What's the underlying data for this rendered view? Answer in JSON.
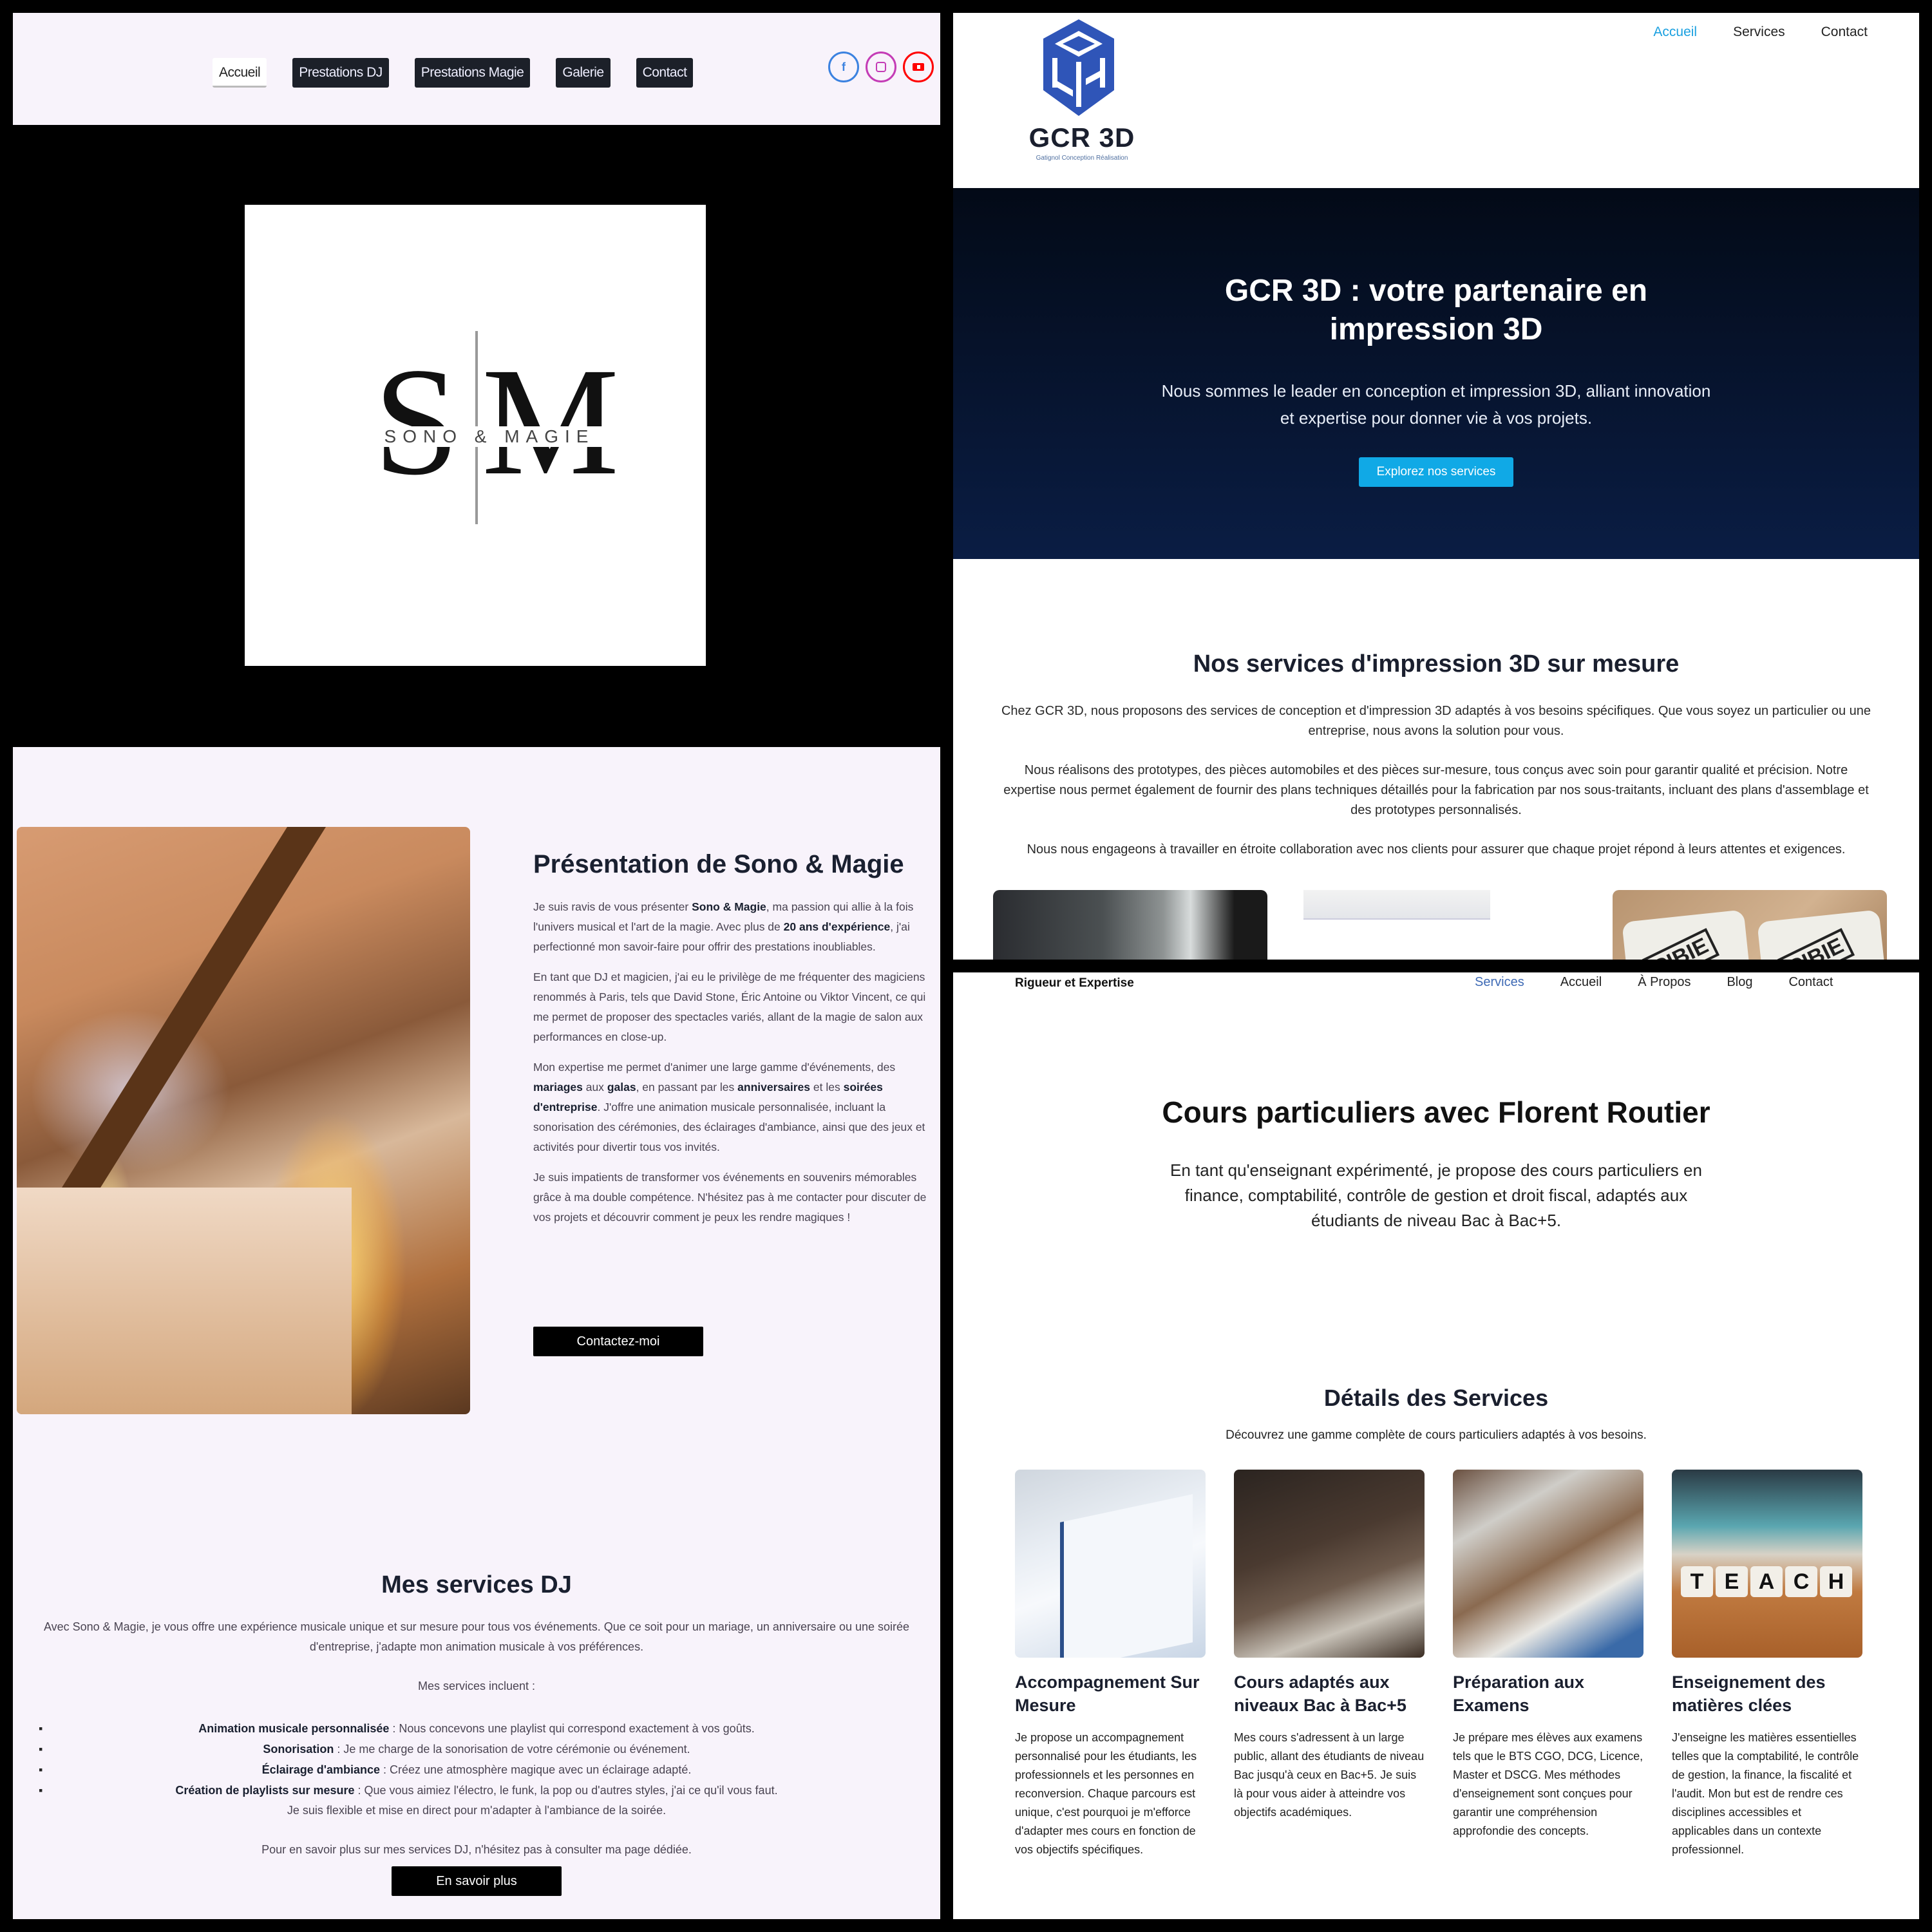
{
  "sono": {
    "nav": [
      {
        "label": "Accueil",
        "active": true
      },
      {
        "label": "Prestations DJ",
        "active": false
      },
      {
        "label": "Prestations Magie",
        "active": false
      },
      {
        "label": "Galerie",
        "active": false
      },
      {
        "label": "Contact",
        "active": false
      }
    ],
    "socials": [
      {
        "name": "facebook",
        "glyph": "f",
        "color": "#3b82e0"
      },
      {
        "name": "instagram",
        "glyph": "",
        "color": "#c43cb6"
      },
      {
        "name": "youtube",
        "glyph": "",
        "color": "#ff0000"
      }
    ],
    "logo": {
      "letter_left": "S",
      "letter_right": "M",
      "name": "SONO & MAGIE"
    },
    "presentation": {
      "title": "Présentation de Sono & Magie",
      "p1": {
        "a": "Je suis ravis de vous présenter ",
        "b1": "Sono & Magie",
        "c": ", ma passion qui allie à la fois l'univers musical et l'art de la magie. Avec plus de ",
        "b2": "20 ans d'expérience",
        "d": ", j'ai perfectionné mon savoir-faire pour offrir des prestations inoubliables."
      },
      "p2": "En tant que DJ et magicien, j'ai eu le privilège de me fréquenter des magiciens renommés à Paris, tels que David Stone, Éric Antoine ou Viktor Vincent, ce qui me permet de proposer des spectacles variés, allant de la magie de salon aux performances en close-up.",
      "p3": {
        "a": "Mon expertise me permet d'animer une large gamme d'événements, des ",
        "b1": "mariages",
        "c": " aux ",
        "b2": "galas",
        "d": ", en passant par les ",
        "b3": "anniversaires",
        "e": " et les ",
        "b4": "soirées d'entreprise",
        "f": ". J'offre une animation musicale personnalisée, incluant la sonorisation des cérémonies, des éclairages d'ambiance, ainsi que des jeux et activités pour divertir tous vos invités."
      },
      "p4": "Je suis impatients de transformer vos événements en souvenirs mémorables grâce à ma double compétence. N'hésitez pas à me contacter pour discuter de vos projets et découvrir comment je peux les rendre magiques !",
      "contact_button": "Contactez-moi"
    },
    "dj_services": {
      "title": "Mes services DJ",
      "intro": "Avec Sono & Magie, je vous offre une expérience musicale unique et sur mesure pour tous vos événements. Que ce soit pour un mariage, un anniversaire ou une soirée d'entreprise, j'adapte mon animation musicale à vos préférences.",
      "sub": "Mes services incluent :",
      "items": [
        {
          "bold": "Animation musicale personnalisée",
          "text": " : Nous concevons une playlist qui correspond exactement à vos goûts."
        },
        {
          "bold": "Sonorisation",
          "text": " : Je me charge de la sonorisation de votre cérémonie ou événement."
        },
        {
          "bold": "Éclairage d'ambiance",
          "text": " : Créez une atmosphère magique avec un éclairage adapté."
        },
        {
          "bold": "Création de playlists sur mesure",
          "text": " : Que vous aimiez l'électro, le funk, la pop ou d'autres styles, j'ai ce qu'il vous faut."
        }
      ],
      "flexible": "Je suis flexible et mise en direct pour m'adapter à l'ambiance de la soirée.",
      "more_text": "Pour en savoir plus sur mes services DJ, n'hésitez pas à consulter ma page dédiée.",
      "more_button": "En savoir plus"
    }
  },
  "gcr": {
    "logo": {
      "word": "GCR 3D",
      "tagline": "Gatignol Conception Réalisation",
      "color": "#2f55b8"
    },
    "nav": [
      {
        "label": "Accueil",
        "active": true
      },
      {
        "label": "Services",
        "active": false
      },
      {
        "label": "Contact",
        "active": false
      }
    ],
    "hero": {
      "title": "GCR 3D : votre partenaire en impression 3D",
      "text": "Nous sommes le leader en conception et impression 3D, alliant innovation et expertise pour donner vie à vos projets.",
      "cta": "Explorez nos services",
      "accent": "#10a9e6"
    },
    "services": {
      "title": "Nos services d'impression 3D sur mesure",
      "p1": "Chez GCR 3D, nous proposons des services de conception et d'impression 3D adaptés à vos besoins spécifiques. Que vous soyez un particulier ou une entreprise, nous avons la solution pour vous.",
      "p2": "Nous réalisons des prototypes, des pièces automobiles et des pièces sur-mesure, tous conçus avec soin pour garantir qualité et précision. Notre expertise nous permet également de fournir des plans techniques détaillés pour la fabrication par nos sous-traitants, incluant des plans d'assemblage et des prototypes personnalisés.",
      "p3": "Nous nous engageons à travailler en étroite collaboration avec nos clients pour assurer que chaque projet répond à leurs attentes et exigences.",
      "card_images": [
        "3d-printer-closeup",
        "cad-software-screenshot",
        "cibie-parts"
      ],
      "cibie_label": "CIBIE"
    }
  },
  "florent": {
    "brand": "Rigueur et Expertise",
    "nav": [
      {
        "label": "Services",
        "active": true
      },
      {
        "label": "Accueil",
        "active": false
      },
      {
        "label": "À Propos",
        "active": false
      },
      {
        "label": "Blog",
        "active": false
      },
      {
        "label": "Contact",
        "active": false
      }
    ],
    "hero": {
      "title": "Cours particuliers avec Florent Routier",
      "text": "En tant qu'enseignant expérimenté, je propose des cours particuliers en finance, comptabilité, contrôle de gestion et droit fiscal, adaptés aux étudiants de niveau Bac à Bac+5."
    },
    "details": {
      "title": "Détails des Services",
      "subtitle": "Découvrez une gamme complète de cours particuliers adaptés à vos besoins.",
      "cards": [
        {
          "title": "Accompagnement Sur Mesure",
          "image": "spreadsheet-charts",
          "text": "Je propose un accompagnement personnalisé pour les étudiants, les professionnels et les personnes en reconversion. Chaque parcours est unique, c'est pourquoi je m'efforce d'adapter mes cours en fonction de vos objectifs spécifiques."
        },
        {
          "title": "Cours adaptés aux niveaux Bac à Bac+5",
          "image": "students-studying",
          "text": "Mes cours s'adressent à un large public, allant des étudiants de niveau Bac jusqu'à ceux en Bac+5. Je suis là pour vous aider à atteindre vos objectifs académiques."
        },
        {
          "title": "Préparation aux Examens",
          "image": "library-study",
          "text": "Je prépare mes élèves aux examens tels que le BTS CGO, DCG, Licence, Master et DSCG. Mes méthodes d'enseignement sont conçues pour garantir une compréhension approfondie des concepts."
        },
        {
          "title": "Enseignement des matières clées",
          "image": "teach-dice",
          "text": "J'enseigne les matières essentielles telles que la comptabilité, le contrôle de gestion, la finance, la fiscalité et l'audit. Mon but est de rendre ces disciplines accessibles et applicables dans un contexte professionnel."
        }
      ],
      "teach_letters": [
        "T",
        "E",
        "A",
        "C",
        "H"
      ]
    }
  }
}
